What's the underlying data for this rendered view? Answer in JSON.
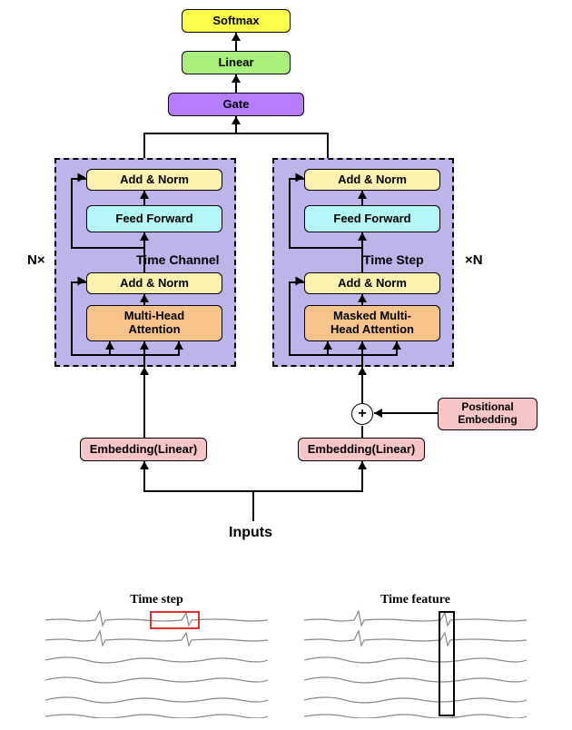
{
  "top": {
    "softmax": "Softmax",
    "linear": "Linear",
    "gate": "Gate"
  },
  "left_branch": {
    "label": "Time Channel",
    "side": "N×",
    "addnorm2": "Add & Norm",
    "ff": "Feed Forward",
    "addnorm1": "Add & Norm",
    "attn": "Multi-Head\nAttention",
    "embed": "Embedding(Linear)"
  },
  "right_branch": {
    "label": "Time Step",
    "side": "×N",
    "addnorm2": "Add & Norm",
    "ff": "Feed Forward",
    "addnorm1": "Add & Norm",
    "attn": "Masked Multi-\nHead Attention",
    "embed": "Embedding(Linear)",
    "posenc": "Positional\nEmbedding"
  },
  "inputs_label": "Inputs",
  "waves": {
    "left_title": "Time step",
    "right_title": "Time feature",
    "left_highlight_color": "#e03030",
    "right_highlight_color": "#000000"
  }
}
